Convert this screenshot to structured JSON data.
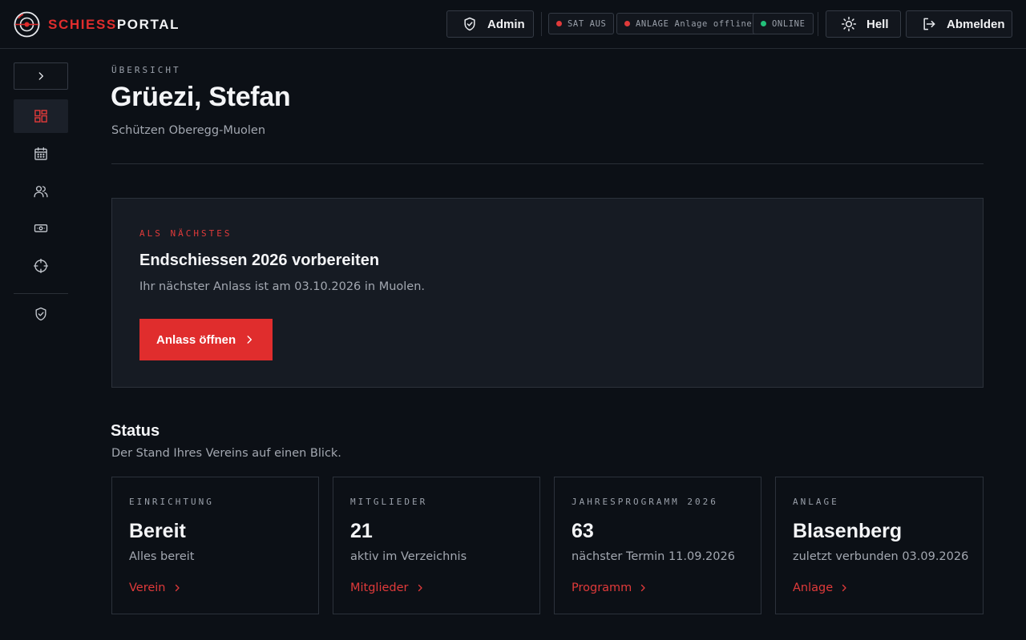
{
  "brand": {
    "part1": "SCHIESS",
    "part2": "PORTAL",
    "logo_icon": "target-logo-icon",
    "accent": "#e02d2d"
  },
  "header": {
    "admin_label": "Admin",
    "status": [
      {
        "text": "SAT AUS",
        "color": "#e03a3a"
      },
      {
        "text": "ANLAGE Anlage offline",
        "color": "#e03a3a"
      },
      {
        "text": "ONLINE",
        "color": "#22c07a"
      }
    ],
    "theme_label": "Hell",
    "logout_label": "Abmelden"
  },
  "sidebar": {
    "items": [
      {
        "icon": "dashboard-icon",
        "active": true
      },
      {
        "icon": "calendar-icon",
        "active": false
      },
      {
        "icon": "users-icon",
        "active": false
      },
      {
        "icon": "money-icon",
        "active": false
      },
      {
        "icon": "crosshair-icon",
        "active": false
      },
      {
        "icon": "shield-check-icon",
        "active": false
      }
    ]
  },
  "overview": {
    "eyebrow": "ÜBERSICHT",
    "greeting": "Grüezi, Stefan",
    "club": "Schützen Oberegg-Muolen"
  },
  "next": {
    "eyebrow": "ALS NÄCHSTES",
    "title": "Endschiessen 2026 vorbereiten",
    "description": "Ihr nächster Anlass ist am 03.10.2026 in Muolen.",
    "button_label": "Anlass öffnen"
  },
  "status_section": {
    "title": "Status",
    "subtitle": "Der Stand Ihres Vereins auf einen Blick.",
    "cards": [
      {
        "label": "EINRICHTUNG",
        "value": "Bereit",
        "desc": "Alles bereit",
        "link": "Verein"
      },
      {
        "label": "MITGLIEDER",
        "value": "21",
        "desc": "aktiv im Verzeichnis",
        "link": "Mitglieder"
      },
      {
        "label": "JAHRESPROGRAMM 2026",
        "value": "63",
        "desc": "nächster Termin 11.09.2026",
        "link": "Programm"
      },
      {
        "label": "ANLAGE",
        "value": "Blasenberg",
        "desc": "zuletzt verbunden 03.09.2026",
        "link": "Anlage"
      }
    ]
  }
}
